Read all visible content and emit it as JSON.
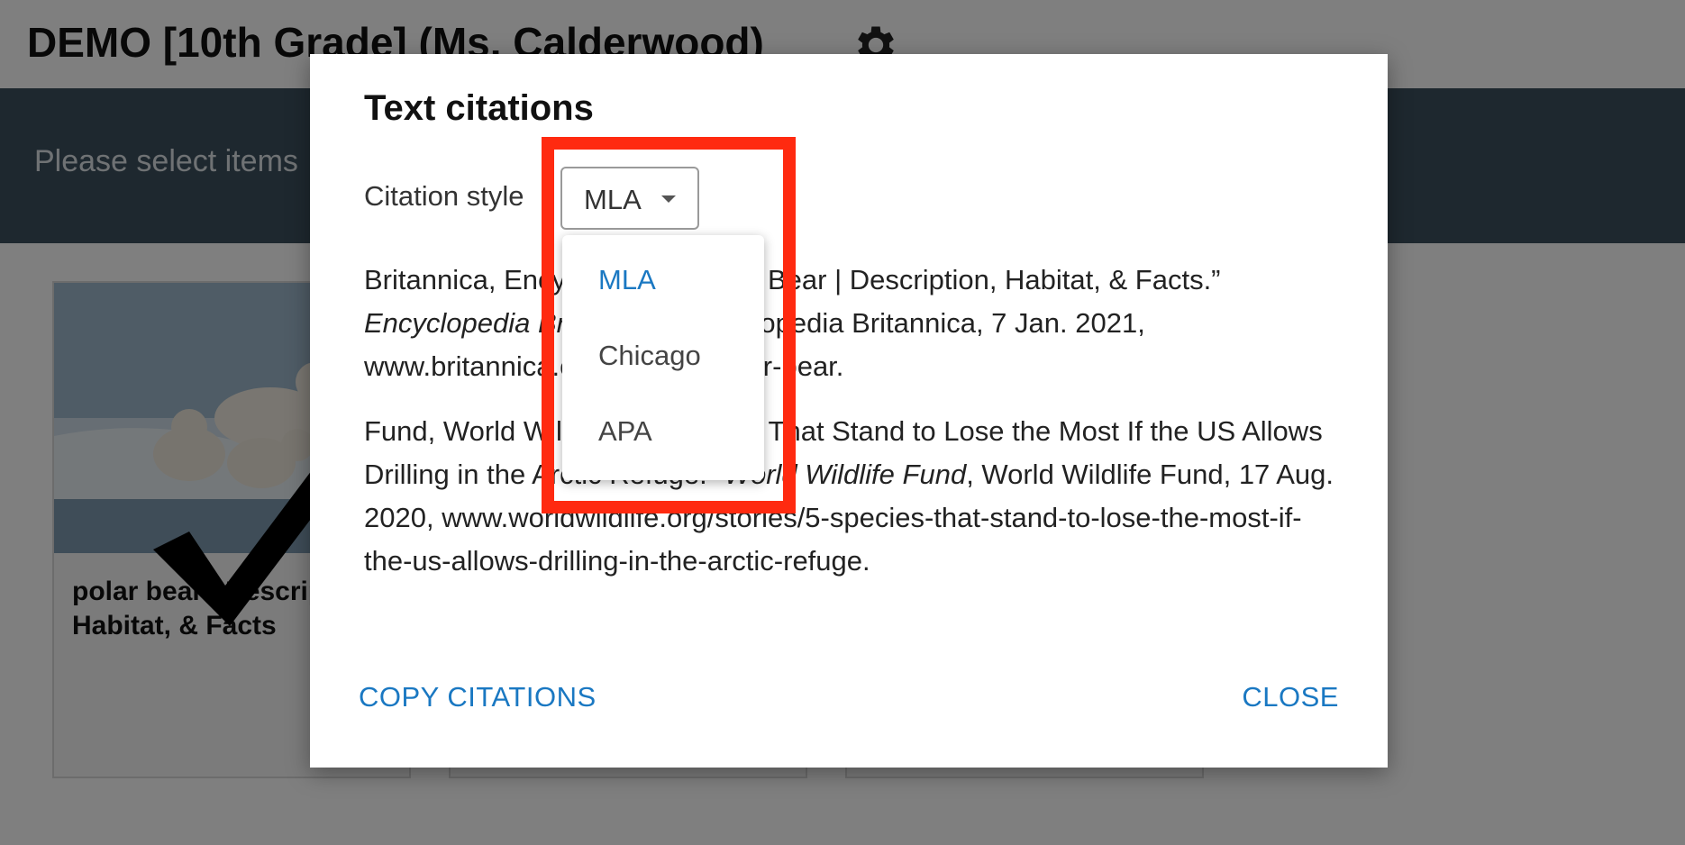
{
  "page": {
    "title": "DEMO [10th Grade] (Ms. Calderwood)",
    "banner_text": "Please select items",
    "cards": [
      {
        "title": "polar bear | Description, Habitat, & Facts",
        "checked": true
      },
      {
        "title": ""
      },
      {
        "title": ""
      }
    ]
  },
  "modal": {
    "title": "Text citations",
    "citation_style_label": "Citation style",
    "citation_style_value": "MLA",
    "citations": [
      {
        "before": "Britannica, Encyclopedia. “Polar Bear | Description, Habitat, & Facts.” ",
        "italic": "Encyclopedia Britannica",
        "after": ", Encyclopedia Britannica, 7 Jan. 2021, www.britannica.com/animal/polar-bear."
      },
      {
        "before": "Fund, World Wildlife. “5 Species That Stand to Lose the Most If the US Allows Drilling in the Arctic Refuge.” ",
        "italic": "World Wildlife Fund",
        "after": ", World Wildlife Fund, 17 Aug. 2020, www.worldwildlife.org/stories/5-species-that-stand-to-lose-the-most-if-the-us-allows-drilling-in-the-arctic-refuge."
      }
    ],
    "copy_button": "COPY CITATIONS",
    "close_button": "CLOSE"
  },
  "dropdown": {
    "options": [
      "MLA",
      "Chicago",
      "APA"
    ],
    "selected": "MLA"
  },
  "colors": {
    "accent": "#1a78c2",
    "banner": "#3c505f",
    "highlight": "#ff2a10"
  },
  "icons": {
    "settings": "gear-icon",
    "dropdown": "caret-down-icon",
    "selected_mark": "checkmark-icon"
  }
}
